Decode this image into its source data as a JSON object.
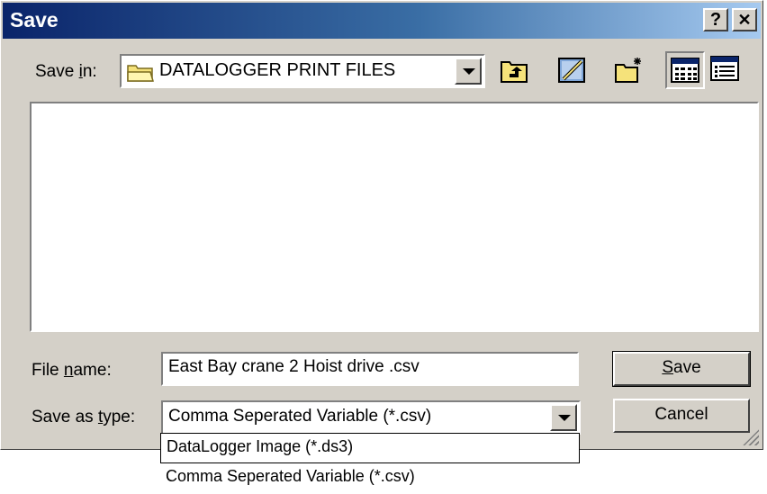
{
  "window": {
    "title": "Save"
  },
  "titlebar": {
    "help_label": "?",
    "close_label": "✕"
  },
  "save_in": {
    "label_before": "Save ",
    "label_mnemonic": "i",
    "label_after": "n:",
    "value": "DATALOGGER PRINT FILES"
  },
  "toolbar": {
    "icons": [
      "up-one-level-icon",
      "browse-desktop-icon",
      "create-new-folder-icon",
      "list-view-icon",
      "details-view-icon"
    ]
  },
  "file_name": {
    "label_before": "File ",
    "label_mnemonic": "n",
    "label_after": "ame:",
    "value": "East Bay crane 2 Hoist drive .csv"
  },
  "save_as_type": {
    "label_before": "Save as ",
    "label_mnemonic": "t",
    "label_after": "ype:",
    "value": "Comma Seperated Variable (*.csv)",
    "options": [
      "DataLogger Image (*.ds3)",
      "Comma Seperated Variable (*.csv)"
    ]
  },
  "buttons": {
    "save_mnemonic": "S",
    "save_rest": "ave",
    "cancel": "Cancel"
  }
}
